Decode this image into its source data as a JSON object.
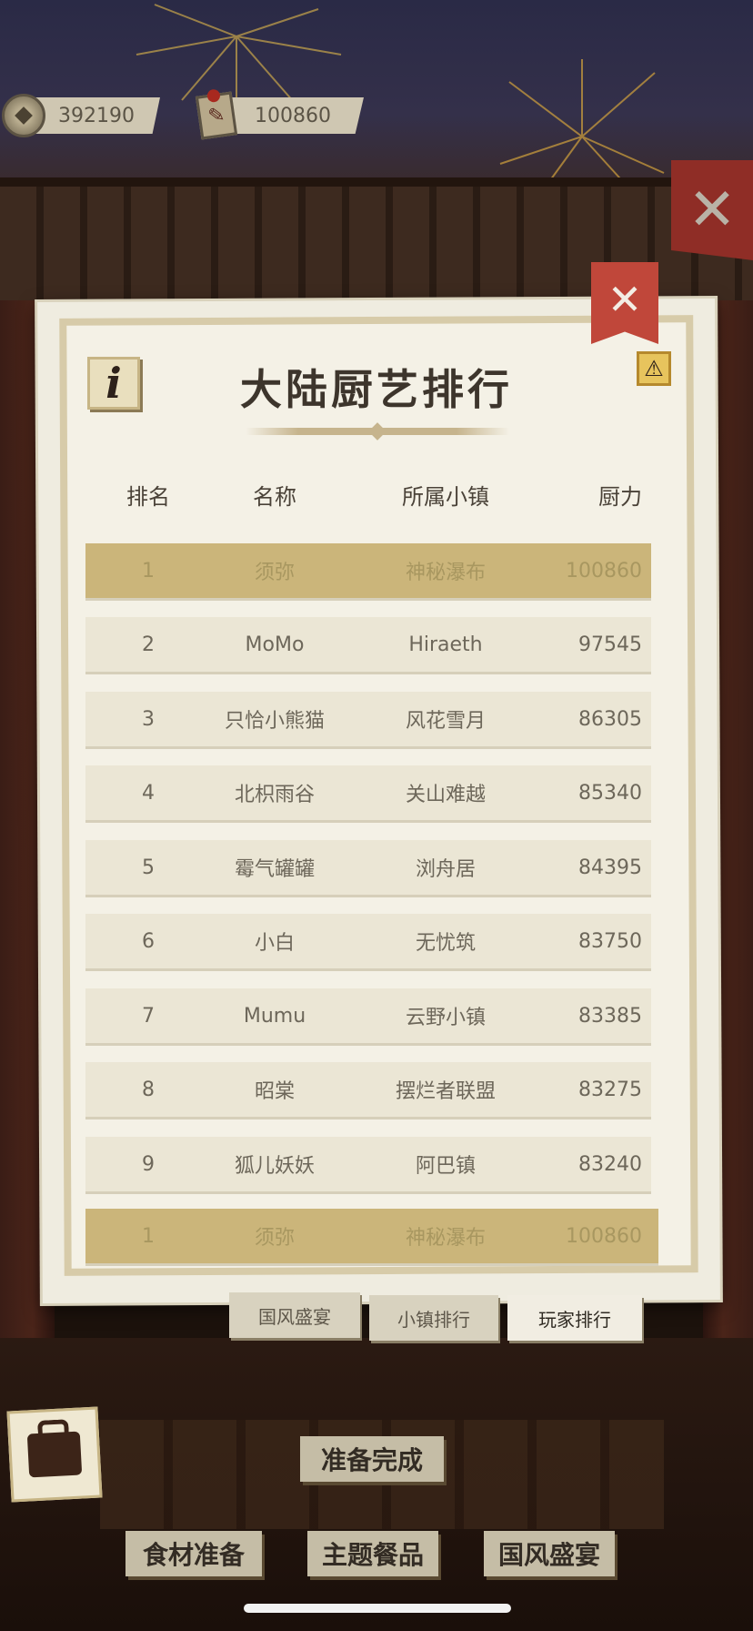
{
  "currency": {
    "coins": "392190",
    "tokens": "100860"
  },
  "panel": {
    "title": "大陆厨艺排行",
    "info_label": "i",
    "columns": [
      "排名",
      "名称",
      "所属小镇",
      "厨力"
    ],
    "rows": [
      {
        "rank": "1",
        "name": "须弥",
        "town": "神秘瀑布",
        "power": "100860"
      },
      {
        "rank": "2",
        "name": "MoMo",
        "town": "Hiraeth",
        "power": "97545"
      },
      {
        "rank": "3",
        "name": "只恰小熊猫",
        "town": "风花雪月",
        "power": "86305"
      },
      {
        "rank": "4",
        "name": "北枳雨谷",
        "town": "关山难越",
        "power": "85340"
      },
      {
        "rank": "5",
        "name": "霉气罐罐",
        "town": "浏舟居",
        "power": "84395"
      },
      {
        "rank": "6",
        "name": "小白",
        "town": "无忧筑",
        "power": "83750"
      },
      {
        "rank": "7",
        "name": "Mumu",
        "town": "云野小镇",
        "power": "83385"
      },
      {
        "rank": "8",
        "name": "昭棠",
        "town": "摆烂者联盟",
        "power": "83275"
      },
      {
        "rank": "9",
        "name": "狐儿妖妖",
        "town": "阿巴镇",
        "power": "83240"
      }
    ],
    "self_row": {
      "rank": "1",
      "name": "须弥",
      "town": "神秘瀑布",
      "power": "100860"
    },
    "tabs": [
      "国风盛宴",
      "小镇排行",
      "玩家排行"
    ]
  },
  "bottom": {
    "ready_button": "准备完成",
    "buttons": [
      "食材准备",
      "主题餐品",
      "国风盛宴"
    ]
  },
  "colors": {
    "highlight": "#cbb57a",
    "close_red": "#c0473a"
  }
}
